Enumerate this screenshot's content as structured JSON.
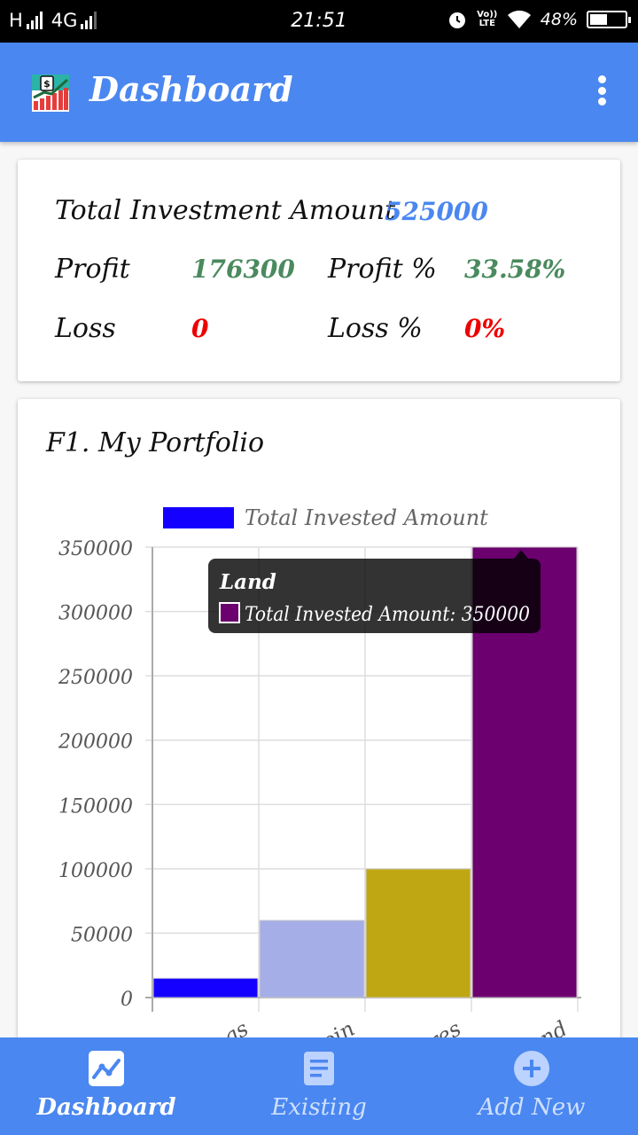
{
  "status_bar": {
    "network_left": "H",
    "network_right": "4G",
    "time": "21:51",
    "volte": "Vo)) LTE",
    "battery": "48%"
  },
  "app_bar": {
    "title": "Dashboard",
    "logo_icon": "money-chart-icon",
    "menu_icon": "more-vert-icon",
    "color": "#4a87f0"
  },
  "summary": {
    "total_label": "Total Investment Amount",
    "total_value": "525000",
    "profit_label": "Profit",
    "profit_value": "176300",
    "profit_pct_label": "Profit %",
    "profit_pct_value": "33.58%",
    "loss_label": "Loss",
    "loss_value": "0",
    "loss_pct_label": "Loss %",
    "loss_pct_value": "0%"
  },
  "portfolio": {
    "title": "F1. My Portfolio"
  },
  "chart_data": {
    "type": "bar",
    "categories": [
      "Savings",
      "Bitcoin",
      "Shares",
      "Land"
    ],
    "visible_tick_labels": [
      "ings",
      "coin",
      "ares",
      "Land"
    ],
    "series": [
      {
        "name": "Total Invested Amount",
        "values": [
          15000,
          60000,
          100000,
          350000
        ]
      }
    ],
    "bar_colors": [
      "#1400ff",
      "#a5aee6",
      "#bfa713",
      "#6b006e"
    ],
    "legend_color": "#1400ff",
    "legend_position": "top",
    "ylim": [
      0,
      350000
    ],
    "yticks": [
      "0",
      "50000",
      "100000",
      "150000",
      "200000",
      "250000",
      "300000",
      "350000"
    ],
    "grid": true,
    "tooltip": {
      "title": "Land",
      "label": "Total Invested Amount: 350000",
      "swatch_color": "#6b006e"
    }
  },
  "bottom_nav": {
    "items": [
      {
        "label": "Dashboard",
        "icon": "chart-line-icon",
        "active": true
      },
      {
        "label": "Existing",
        "icon": "document-list-icon",
        "active": false
      },
      {
        "label": "Add New",
        "icon": "add-circle-icon",
        "active": false
      }
    ]
  }
}
